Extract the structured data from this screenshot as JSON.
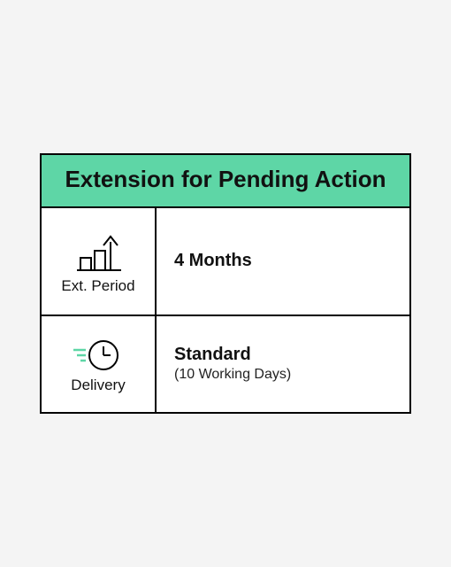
{
  "header": {
    "title": "Extension for Pending Action"
  },
  "rows": {
    "period": {
      "label": "Ext. Period",
      "value": "4 Months"
    },
    "delivery": {
      "label": "Delivery",
      "value": "Standard",
      "sub": "(10 Working Days)"
    }
  }
}
